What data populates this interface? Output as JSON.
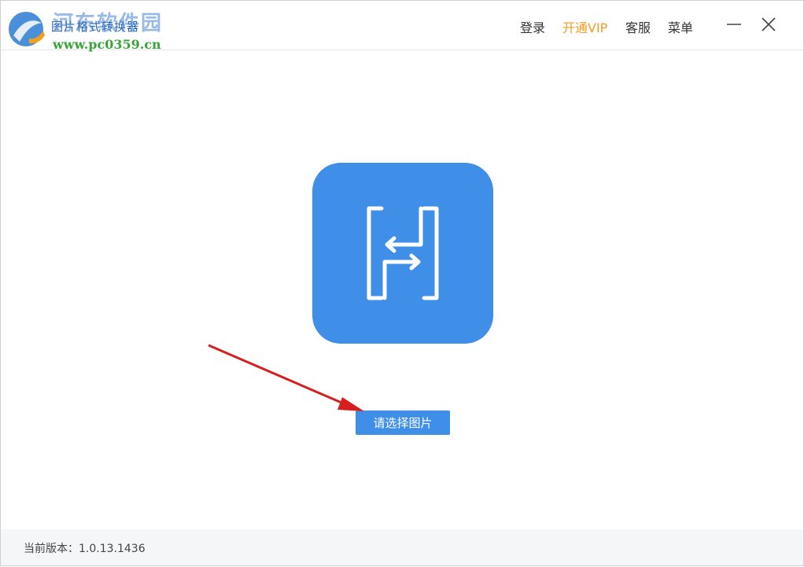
{
  "app": {
    "title": "图片格式转换器",
    "watermark_main": "河东软件园",
    "watermark_url": "www.pc0359.cn"
  },
  "header": {
    "login_label": "登录",
    "vip_label": "开通VIP",
    "service_label": "客服",
    "menu_label": "菜单",
    "vip_color": "#f59a23"
  },
  "main": {
    "icon": "convert-app-icon",
    "select_button_label": "请选择图片",
    "accent_color": "#3f8ee8"
  },
  "footer": {
    "version_label": "当前版本：1.0.13.1436"
  }
}
